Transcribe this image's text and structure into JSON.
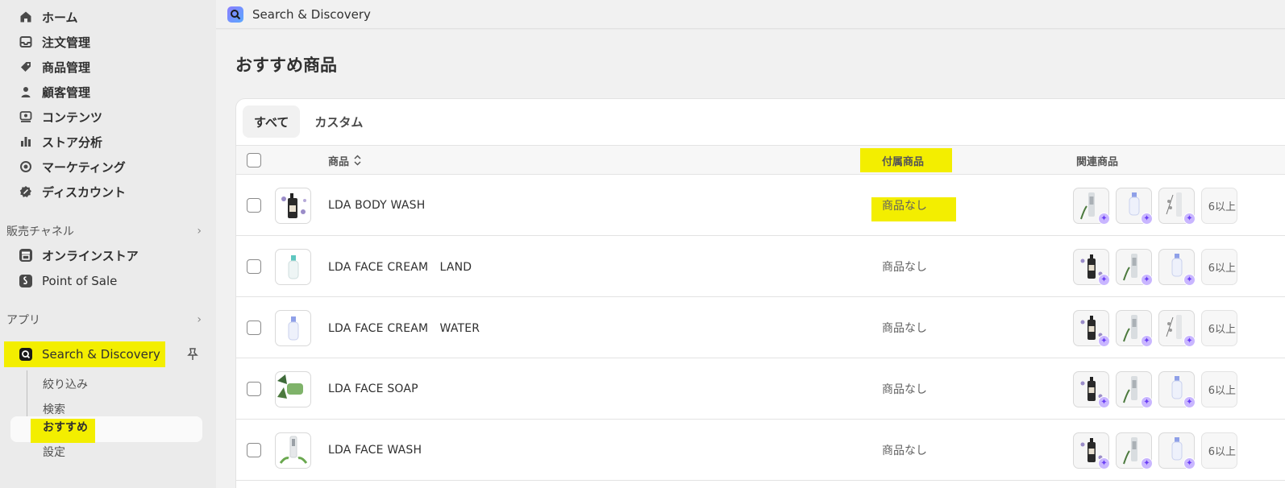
{
  "sidebar": {
    "nav": [
      {
        "label": "ホーム",
        "icon": "home-icon"
      },
      {
        "label": "注文管理",
        "icon": "inbox-icon"
      },
      {
        "label": "商品管理",
        "icon": "tag-icon"
      },
      {
        "label": "顧客管理",
        "icon": "person-icon"
      },
      {
        "label": "コンテンツ",
        "icon": "image-icon"
      },
      {
        "label": "ストア分析",
        "icon": "bar-chart-icon"
      },
      {
        "label": "マーケティング",
        "icon": "target-icon"
      },
      {
        "label": "ディスカウント",
        "icon": "discount-icon"
      }
    ],
    "sales_channels_label": "販売チャネル",
    "channels": [
      {
        "label": "オンラインストア",
        "icon": "store-icon"
      },
      {
        "label": "Point of Sale",
        "icon": "pos-icon"
      }
    ],
    "apps_label": "アプリ",
    "app": {
      "label": "Search & Discovery",
      "icon": "search-discovery-icon"
    },
    "app_subitems": [
      "絞り込み",
      "検索",
      "おすすめ",
      "設定"
    ]
  },
  "topbar": {
    "title": "Search & Discovery"
  },
  "page": {
    "title": "おすすめ商品"
  },
  "tabs": [
    "すべて",
    "カスタム"
  ],
  "table": {
    "headers": {
      "product": "商品",
      "included": "付属商品",
      "related": "関連商品"
    },
    "rows": [
      {
        "name": "LDA BODY WASH",
        "included": "商品なし",
        "more": "6以上"
      },
      {
        "name": "LDA FACE CREAM　LAND",
        "included": "商品なし",
        "more": "6以上"
      },
      {
        "name": "LDA FACE CREAM　WATER",
        "included": "商品なし",
        "more": "6以上"
      },
      {
        "name": "LDA FACE SOAP",
        "included": "商品なし",
        "more": "6以上"
      },
      {
        "name": "LDA FACE WASH",
        "included": "商品なし",
        "more": "6以上"
      }
    ]
  },
  "colors": {
    "highlight": "#f3ee00",
    "accent_purple": "#6a3ef5"
  }
}
